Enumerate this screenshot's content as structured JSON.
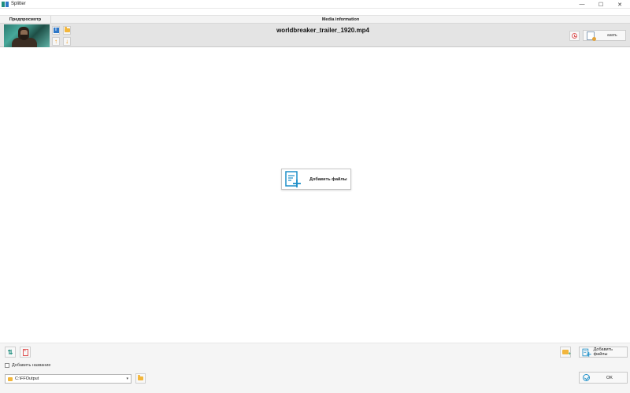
{
  "window": {
    "title": "Splitter",
    "minimize_glyph": "—",
    "maximize_glyph": "☐",
    "close_glyph": "✕"
  },
  "header": {
    "preview": "Предпросмотр",
    "media_info": "Media information"
  },
  "file": {
    "name": "worldbreaker_trailer_1920.mp4",
    "info_glyph": "i",
    "up_glyph": "↑",
    "down_glyph": "↓",
    "cut_label": "азать"
  },
  "center": {
    "add_files_label": "Добавить файлы"
  },
  "bottom": {
    "add_title_label": "Добавить название",
    "output_path": "C:\\FFOutput",
    "path_arrow": "▾",
    "sort_glyph": "⇅",
    "add_files_label": "Добавить файлы",
    "ok_label": "OK"
  },
  "colors": {
    "accent": "#1e8fc8",
    "folder": "#f2b63c",
    "arrow": "#ee9a1e",
    "remove": "#e05a5a"
  },
  "icons": [
    "app-icon",
    "info-icon",
    "folder-icon",
    "arrow-up-icon",
    "arrow-down-icon",
    "clock-icon",
    "cut-icon",
    "add-files-icon",
    "sort-icon",
    "clear-icon",
    "add-folder-icon",
    "check-circle-icon"
  ]
}
